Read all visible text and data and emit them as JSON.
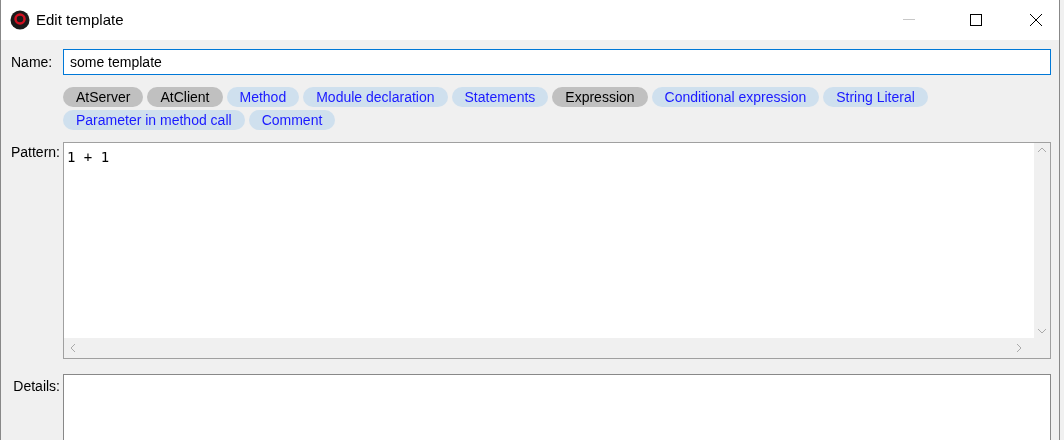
{
  "window": {
    "title": "Edit template",
    "minimize_disabled": true
  },
  "name": {
    "label": "Name:",
    "value": "some template"
  },
  "tags": [
    {
      "label": "AtServer",
      "selected": true
    },
    {
      "label": "AtClient",
      "selected": true
    },
    {
      "label": "Method",
      "selected": false
    },
    {
      "label": "Module declaration",
      "selected": false
    },
    {
      "label": "Statements",
      "selected": false
    },
    {
      "label": "Expression",
      "selected": true
    },
    {
      "label": "Conditional expression",
      "selected": false
    },
    {
      "label": "String Literal",
      "selected": false
    },
    {
      "label": "Parameter in method call",
      "selected": false
    },
    {
      "label": "Comment",
      "selected": false
    }
  ],
  "pattern": {
    "label": "Pattern:",
    "value": "1 + 1"
  },
  "details": {
    "label": "Details:"
  }
}
